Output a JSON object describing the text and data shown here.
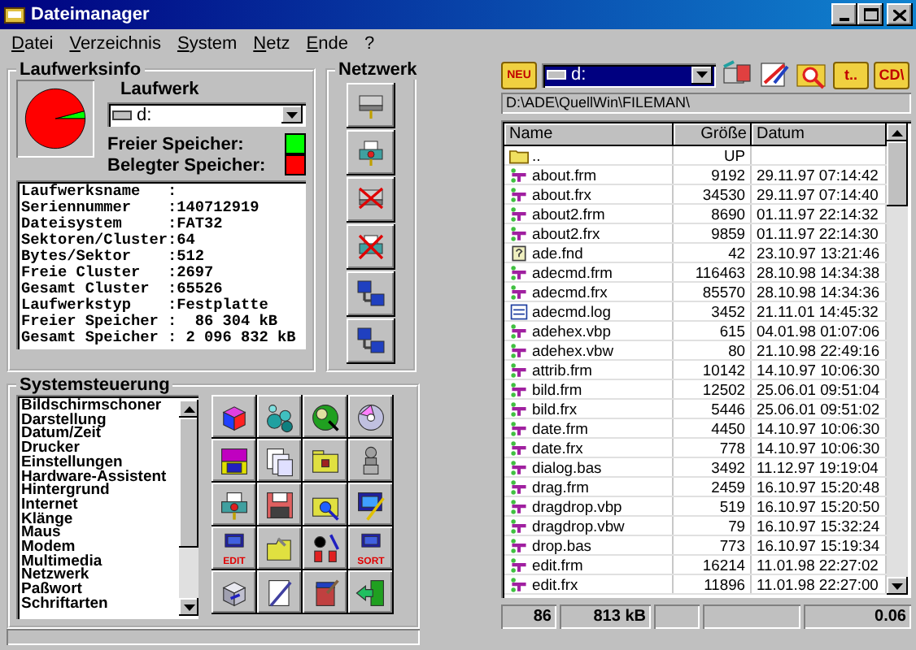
{
  "window": {
    "title": "Dateimanager"
  },
  "menu": [
    "Datei",
    "Verzeichnis",
    "System",
    "Netz",
    "Ende",
    "?"
  ],
  "drive_info": {
    "title": "Laufwerksinfo",
    "drive_label": "Laufwerk",
    "drive": "d:",
    "chart_data": {
      "type": "pie",
      "values": [
        4.1,
        95.9
      ]
    },
    "legend": [
      {
        "label": "Freier Speicher:",
        "color": "#00ff00"
      },
      {
        "label": "Belegter Speicher:",
        "color": "#ff0000"
      }
    ],
    "lines": [
      "Laufwerksname   :",
      "Seriennummer    :140712919",
      "Dateisystem     :FAT32",
      "Sektoren/Cluster:64",
      "Bytes/Sektor    :512",
      "Freie Cluster   :2697",
      "Gesamt Cluster  :65526",
      "Laufwerkstyp    :Festplatte",
      "Freier Speicher :  86 304 kB",
      "Gesamt Speicher : 2 096 832 kB"
    ]
  },
  "network": {
    "title": "Netzwerk",
    "buttons": [
      {
        "kind": "drive"
      },
      {
        "kind": "printer"
      },
      {
        "kind": "drive-cross"
      },
      {
        "kind": "printer-cross"
      },
      {
        "kind": "computers"
      },
      {
        "kind": "computers"
      }
    ]
  },
  "control_panel": {
    "title": "Systemsteuerung",
    "items": [
      "Bildschirmschoner",
      "Darstellung",
      "Datum/Zeit",
      "Drucker",
      "Einstellungen",
      "Hardware-Assistent",
      "Hintergrund",
      "Internet",
      "Klänge",
      "Maus",
      "Modem",
      "Multimedia",
      "Netzwerk",
      "Paßwort",
      "Schriftarten"
    ],
    "buttons": [
      {
        "kind": "cube"
      },
      {
        "kind": "bubbles"
      },
      {
        "kind": "globe"
      },
      {
        "kind": "disc"
      },
      {
        "kind": "logo"
      },
      {
        "kind": "documents"
      },
      {
        "kind": "folder"
      },
      {
        "kind": "figure"
      },
      {
        "kind": "printer"
      },
      {
        "kind": "floppy"
      },
      {
        "kind": "folder-search"
      },
      {
        "kind": "monitor"
      },
      {
        "kind": "screen",
        "label": "EDIT"
      },
      {
        "kind": "open-folder"
      },
      {
        "kind": "letters"
      },
      {
        "kind": "screen",
        "label": "SORT"
      },
      {
        "kind": "box"
      },
      {
        "kind": "notepad"
      },
      {
        "kind": "bucket"
      },
      {
        "kind": "exit"
      }
    ]
  },
  "toolbar": {
    "new_label": "NEU",
    "drive": "d:",
    "temp_label": "t..",
    "cd_label": "CD\\"
  },
  "path": "D:\\ADE\\QuellWin\\FILEMAN\\",
  "table": {
    "columns": [
      "Name",
      "Größe",
      "Datum"
    ],
    "rows": [
      {
        "kind": "up",
        "name": "..",
        "size": "UP"
      },
      {
        "kind": "form",
        "name": "about.frm",
        "size": "9192",
        "date": "29.11.97 07:14:42"
      },
      {
        "kind": "form",
        "name": "about.frx",
        "size": "34530",
        "date": "29.11.97 07:14:40"
      },
      {
        "kind": "form",
        "name": "about2.frm",
        "size": "8690",
        "date": "01.11.97 22:14:32"
      },
      {
        "kind": "form",
        "name": "about2.frx",
        "size": "9859",
        "date": "01.11.97 22:14:30"
      },
      {
        "kind": "help",
        "name": "ade.fnd",
        "size": "42",
        "date": "23.10.97 13:21:46"
      },
      {
        "kind": "form",
        "name": "adecmd.frm",
        "size": "116463",
        "date": "28.10.98 14:34:38"
      },
      {
        "kind": "form",
        "name": "adecmd.frx",
        "size": "85570",
        "date": "28.10.98 14:34:36"
      },
      {
        "kind": "log",
        "name": "adecmd.log",
        "size": "3452",
        "date": "21.11.01 14:45:32"
      },
      {
        "kind": "form",
        "name": "adehex.vbp",
        "size": "615",
        "date": "04.01.98 01:07:06"
      },
      {
        "kind": "form",
        "name": "adehex.vbw",
        "size": "80",
        "date": "21.10.98 22:49:16"
      },
      {
        "kind": "form",
        "name": "attrib.frm",
        "size": "10142",
        "date": "14.10.97 10:06:30"
      },
      {
        "kind": "form",
        "name": "bild.frm",
        "size": "12502",
        "date": "25.06.01 09:51:04"
      },
      {
        "kind": "form",
        "name": "bild.frx",
        "size": "5446",
        "date": "25.06.01 09:51:02"
      },
      {
        "kind": "form",
        "name": "date.frm",
        "size": "4450",
        "date": "14.10.97 10:06:30"
      },
      {
        "kind": "form",
        "name": "date.frx",
        "size": "778",
        "date": "14.10.97 10:06:30"
      },
      {
        "kind": "form",
        "name": "dialog.bas",
        "size": "3492",
        "date": "11.12.97 19:19:04"
      },
      {
        "kind": "form",
        "name": "drag.frm",
        "size": "2459",
        "date": "16.10.97 15:20:48"
      },
      {
        "kind": "form",
        "name": "dragdrop.vbp",
        "size": "519",
        "date": "16.10.97 15:20:50"
      },
      {
        "kind": "form",
        "name": "dragdrop.vbw",
        "size": "79",
        "date": "16.10.97 15:32:24"
      },
      {
        "kind": "form",
        "name": "drop.bas",
        "size": "773",
        "date": "16.10.97 15:19:34"
      },
      {
        "kind": "form",
        "name": "edit.frm",
        "size": "16214",
        "date": "11.01.98 22:27:02"
      },
      {
        "kind": "form",
        "name": "edit.frx",
        "size": "11896",
        "date": "11.01.98 22:27:00"
      }
    ]
  },
  "status_bar": {
    "count": "86",
    "size": "813 kB",
    "time": "0.06"
  }
}
